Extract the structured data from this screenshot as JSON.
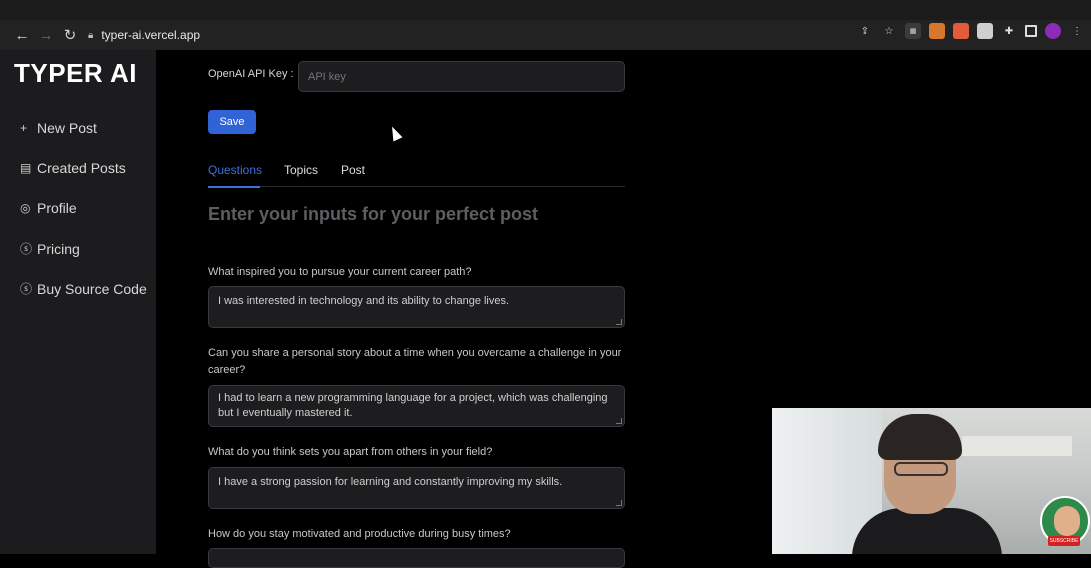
{
  "browser": {
    "url": "typer-ai.vercel.app",
    "back_icon": "arrow-left-icon",
    "forward_icon": "arrow-right-icon",
    "reload_icon": "reload-icon",
    "extensions": [
      "share-icon",
      "star-icon",
      "extension-a-icon",
      "metamask-icon",
      "extension-b-icon",
      "extension-c-icon",
      "puzzle-icon",
      "sidebar-icon",
      "profile-icon",
      "menu-icon"
    ]
  },
  "sidebar": {
    "logo": "TYPER AI",
    "items": [
      {
        "icon": "plus-icon",
        "label": "New Post"
      },
      {
        "icon": "list-icon",
        "label": "Created Posts"
      },
      {
        "icon": "user-icon",
        "label": "Profile"
      },
      {
        "icon": "dollar-icon",
        "label": "Pricing"
      },
      {
        "icon": "dollar-icon",
        "label": "Buy Source Code"
      }
    ]
  },
  "main": {
    "api_key_label": "OpenAI API Key :",
    "api_key_placeholder": "API key",
    "save_label": "Save",
    "tabs": [
      {
        "label": "Questions",
        "active": true
      },
      {
        "label": "Topics",
        "active": false
      },
      {
        "label": "Post",
        "active": false
      }
    ],
    "heading": "Enter your inputs for your perfect post",
    "questions": [
      {
        "question": "What inspired you to pursue your current career path?",
        "answer": "I was interested in technology and its ability to change lives."
      },
      {
        "question": "Can you share a personal story about a time when you overcame a challenge in your career?",
        "answer": "I had to learn a new programming language for a project, which was challenging but I eventually mastered it."
      },
      {
        "question": "What do you think sets you apart from others in your field?",
        "answer": "I have a strong passion for learning and constantly improving my skills."
      },
      {
        "question": "How do you stay motivated and productive during busy times?",
        "answer": ""
      }
    ]
  },
  "overlay": {
    "subscribe_badge": "SUBSCRIBE"
  },
  "colors": {
    "accent": "#2f63d6",
    "tab_active": "#3f6fd8",
    "sidebar_bg": "#1c1c1e",
    "page_bg": "#000000"
  }
}
